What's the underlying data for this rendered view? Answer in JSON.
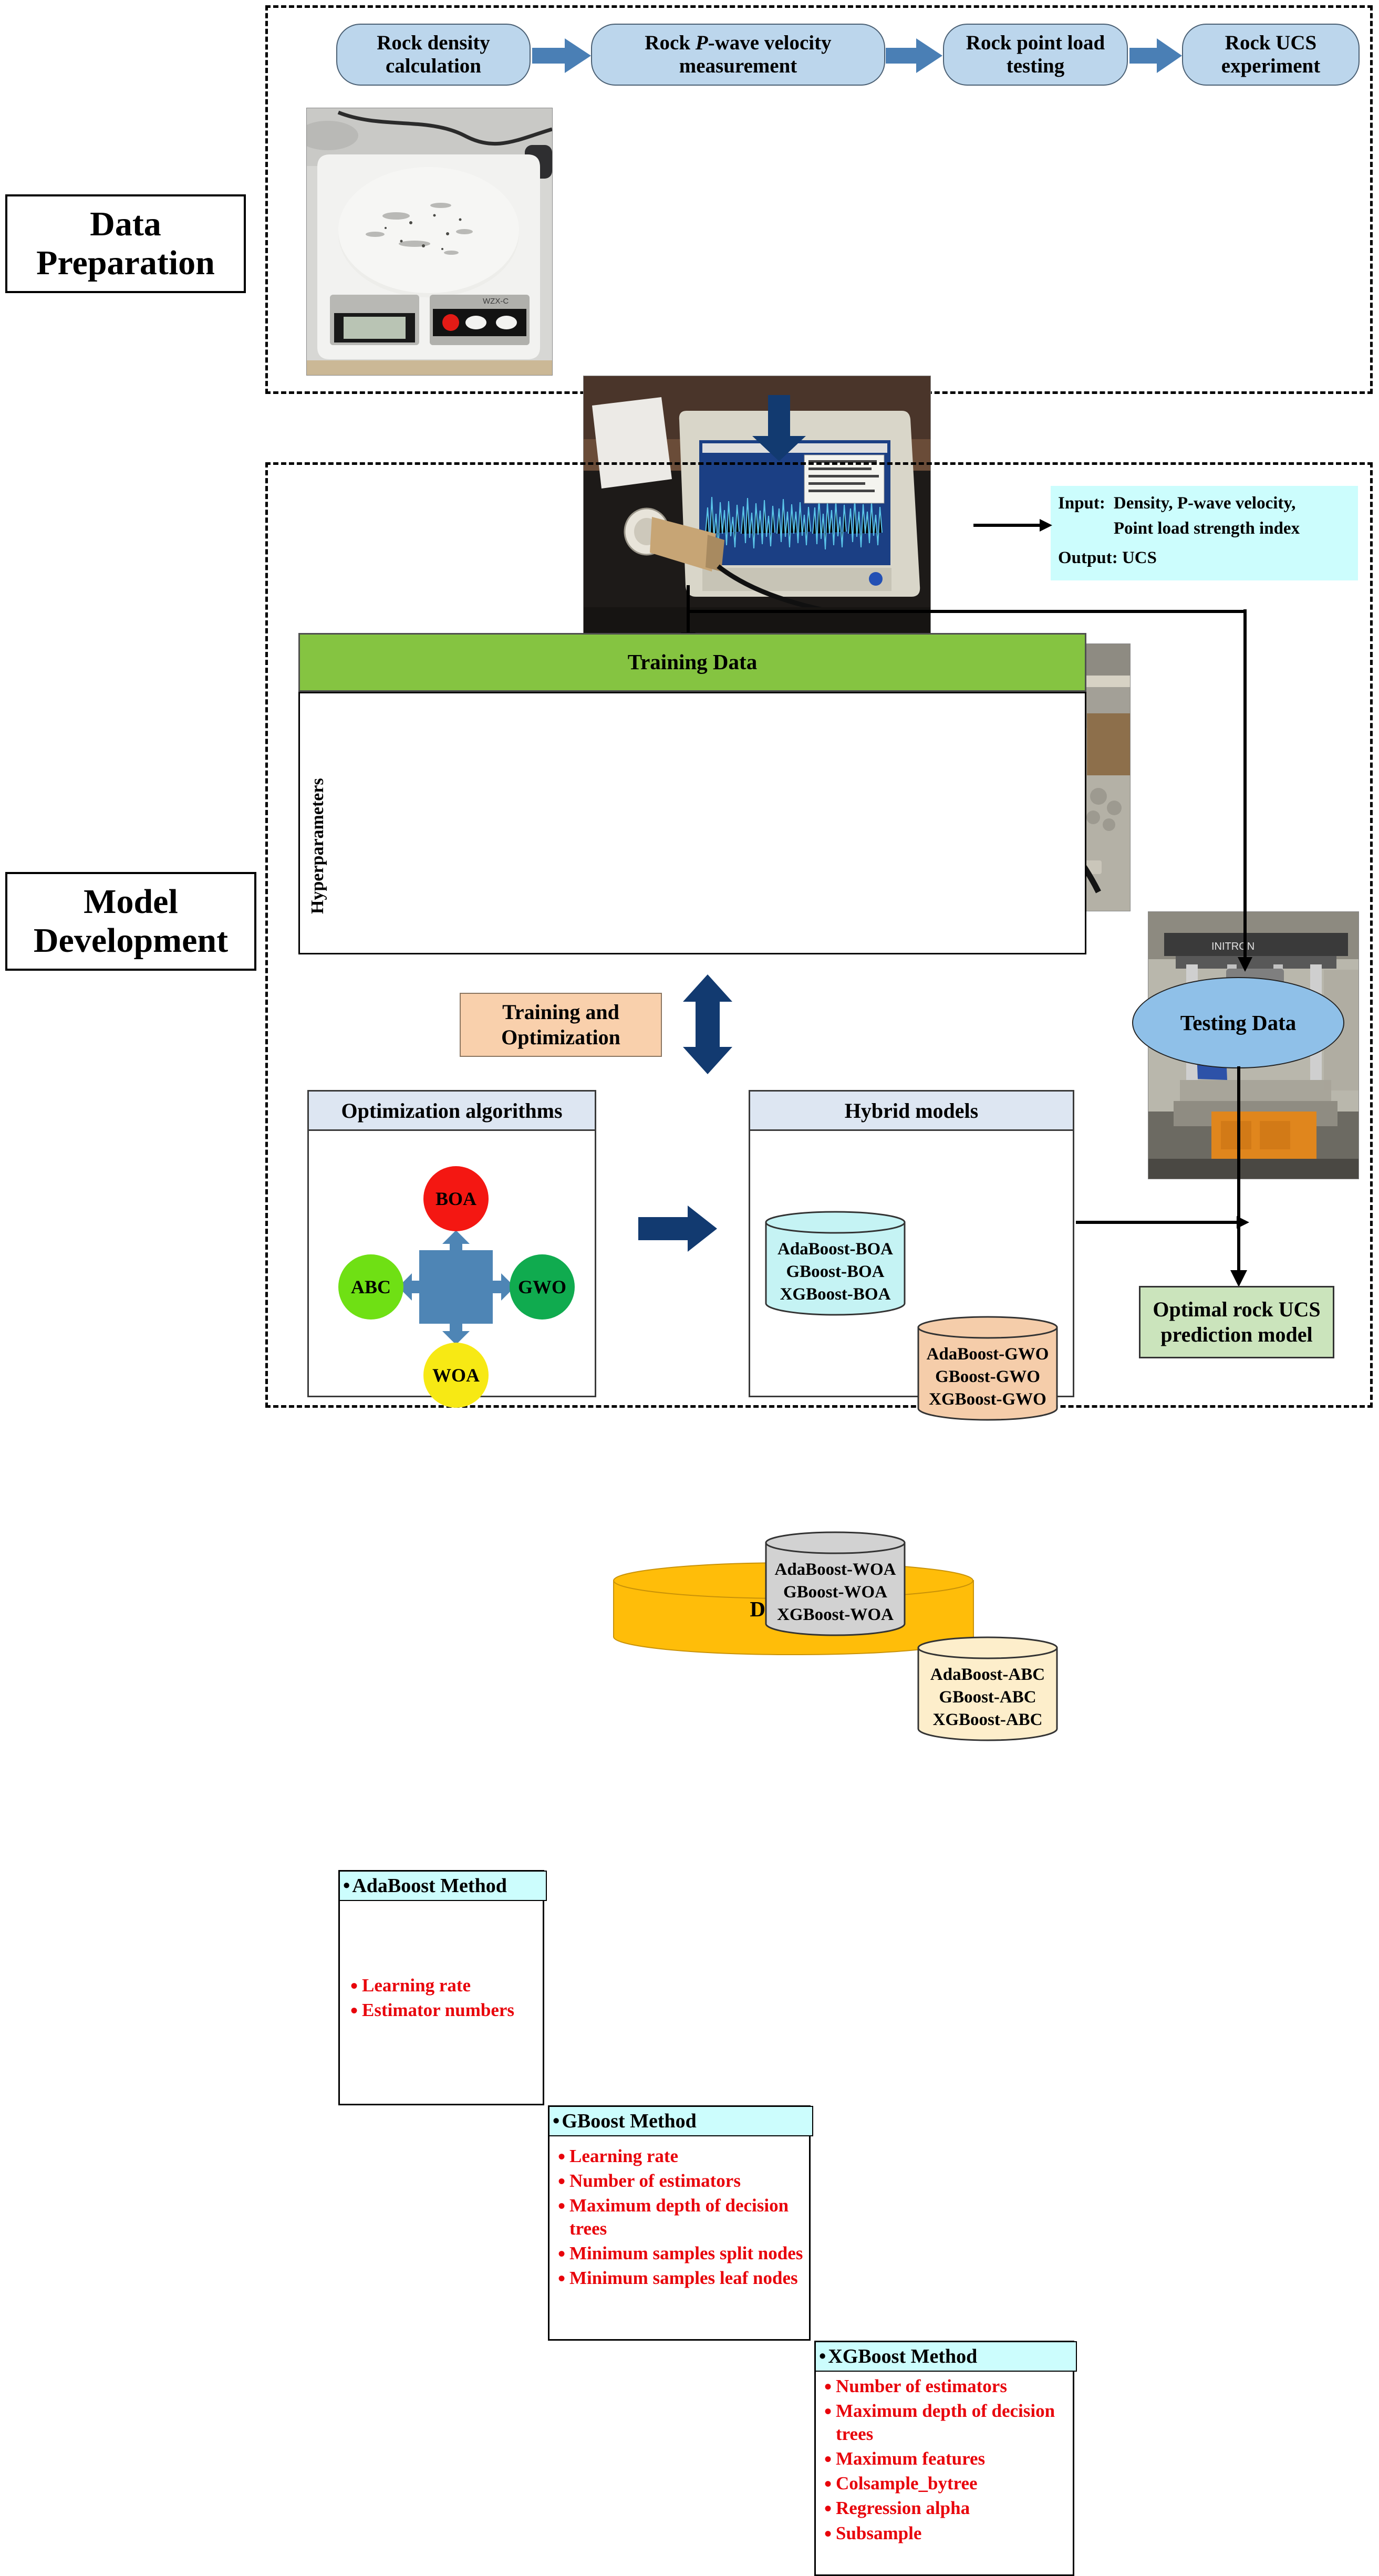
{
  "stages": [
    {
      "id": "data-preparation",
      "label": "Data\nPreparation"
    },
    {
      "id": "model-development",
      "label": "Model\nDevelopment"
    }
  ],
  "data_preparation": {
    "steps": [
      {
        "label": "Rock density calculation",
        "photo": "digital-balance-weighing-rock-disc"
      },
      {
        "label": "Rock P-wave velocity measurement",
        "photo": "ultrasonic-wave-tester-with-core-sample"
      },
      {
        "label": "Rock point load testing",
        "photo": "point-load-test-frame-with-hydraulic-jack"
      },
      {
        "label": "Rock UCS experiment",
        "photo": "servo-hydraulic-compression-testing-machine"
      }
    ],
    "step_labels_rich": [
      {
        "pre": "Rock density",
        "em": "",
        "post": "calculation"
      },
      {
        "pre": "Rock ",
        "em": "P",
        "post": "-wave velocity measurement"
      },
      {
        "pre": "Rock point load",
        "em": "",
        "post": "testing"
      },
      {
        "pre": "Rock UCS",
        "em": "",
        "post": "experiment"
      }
    ]
  },
  "model_development": {
    "database": {
      "label": "DataBase"
    },
    "io_box": {
      "input_label": "Input:",
      "input_line1": "Density, P-wave velocity,",
      "input_line2": "Point load strength index",
      "output_label": "Output:",
      "output_value": "UCS"
    },
    "training_data": {
      "label": "Training Data"
    },
    "hyperparameters": {
      "side_label": "Hyperparameters",
      "methods": [
        {
          "name": "AdaBoost Method",
          "params": [
            "Learning rate",
            "Estimator numbers"
          ]
        },
        {
          "name": "GBoost Method",
          "params": [
            "Learning rate",
            "Number of estimators",
            "Maximum depth of decision trees",
            "Minimum samples split nodes",
            "Minimum samples leaf nodes"
          ]
        },
        {
          "name": "XGBoost Method",
          "params": [
            "Number of estimators",
            "Maximum depth of decision trees",
            "Maximum features",
            "Colsample_bytree",
            "Regression alpha",
            "Subsample"
          ]
        }
      ]
    },
    "training_optimization": {
      "label": "Training and Optimization"
    },
    "optimization_algorithms": {
      "title": "Optimization algorithms",
      "items": [
        {
          "name": "BOA",
          "color": "#f41712",
          "position": "top"
        },
        {
          "name": "ABC",
          "color": "#6fe014",
          "position": "left"
        },
        {
          "name": "GWO",
          "color": "#10ab4f",
          "position": "right"
        },
        {
          "name": "WOA",
          "color": "#f7e914",
          "position": "bottom"
        }
      ],
      "hub_color": "#4e85b5"
    },
    "hybrid_models": {
      "title": "Hybrid models",
      "groups": [
        {
          "suffix": "BOA",
          "color": "#c5f3f4",
          "models": [
            "AdaBoost-BOA",
            "GBoost-BOA",
            "XGBoost-BOA"
          ]
        },
        {
          "suffix": "GWO",
          "color": "#f5cdaa",
          "models": [
            "AdaBoost-GWO",
            "GBoost-GWO",
            "XGBoost-GWO"
          ]
        },
        {
          "suffix": "WOA",
          "color": "#d2d2d2",
          "models": [
            "AdaBoost-WOA",
            "GBoost-WOA",
            "XGBoost-WOA"
          ]
        },
        {
          "suffix": "ABC",
          "color": "#fdeecb",
          "models": [
            "AdaBoost-ABC",
            "GBoost-ABC",
            "XGBoost-ABC"
          ]
        }
      ]
    },
    "testing_data": {
      "label": "Testing Data"
    },
    "optimal_model": {
      "label": "Optimal rock UCS prediction model"
    }
  },
  "colors": {
    "process_box_fill": "#bcd6ec",
    "block_arrow": "#4a7fb5",
    "navy_arrow": "#123a70",
    "database_fill": "#ffbd09",
    "io_fill": "#ccfdfd",
    "training_data_fill": "#85c441",
    "method_header_fill": "#ccfdfd",
    "hyperparam_text": "#e8030b",
    "train_opt_fill": "#f9d0ac",
    "panel_header_fill": "#dde6f2",
    "testing_oval_fill": "#8fc0e8",
    "optimal_fill": "#cbe4bc"
  }
}
